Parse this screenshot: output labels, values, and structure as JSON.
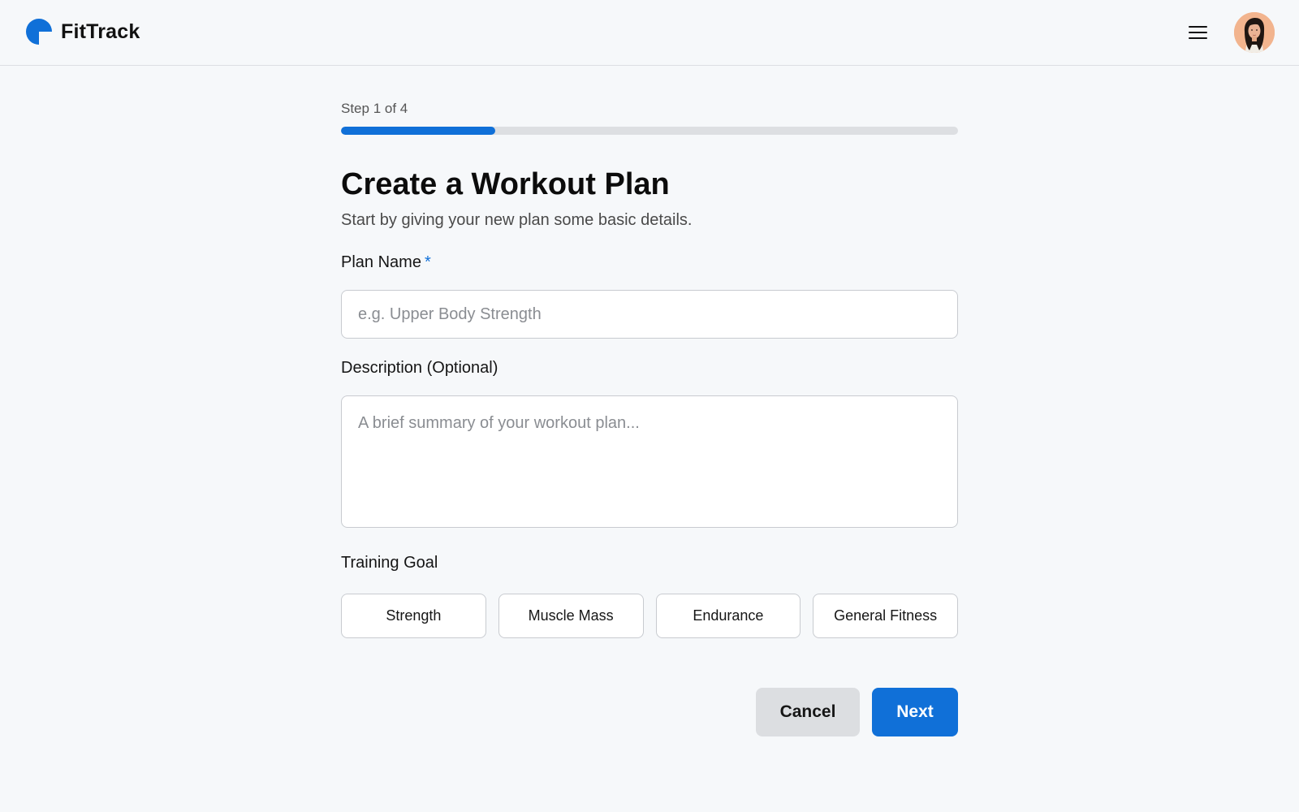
{
  "header": {
    "brand_name": "FitTrack",
    "accent_color": "#1070d8",
    "menu_icon": "hamburger-menu-icon",
    "avatar_icon": "user-avatar"
  },
  "progress": {
    "step_label": "Step 1 of 4",
    "fraction": 0.25
  },
  "form": {
    "title": "Create a Workout Plan",
    "subtitle": "Start by giving your new plan some basic details.",
    "plan_name": {
      "label": "Plan Name",
      "required_marker": "*",
      "value": "",
      "placeholder": "e.g. Upper Body Strength"
    },
    "description": {
      "label": "Description (Optional)",
      "value": "",
      "placeholder": "A brief summary of your workout plan..."
    },
    "training_goal": {
      "label": "Training Goal",
      "options": [
        "Strength",
        "Muscle Mass",
        "Endurance",
        "General Fitness"
      ]
    }
  },
  "actions": {
    "cancel_label": "Cancel",
    "next_label": "Next"
  }
}
